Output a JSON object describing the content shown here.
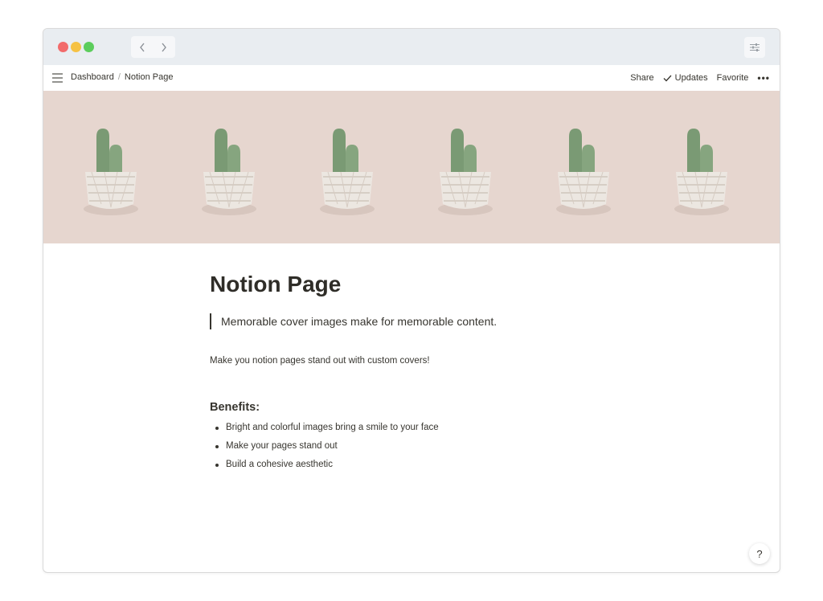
{
  "window": {
    "traffic_lights": [
      "close",
      "minimize",
      "zoom"
    ],
    "nav": {
      "back_icon": "chevron-left-icon",
      "forward_icon": "chevron-right-icon"
    },
    "settings_icon": "sliders-icon"
  },
  "topbar": {
    "breadcrumb": [
      "Dashboard",
      "Notion Page"
    ],
    "breadcrumb_separator": "/",
    "actions": {
      "share": "Share",
      "updates": "Updates",
      "favorite": "Favorite",
      "more": "•••"
    }
  },
  "cover": {
    "background": "#e6d6cf",
    "image": "repeating potted cactus pattern",
    "cactus_count": 6
  },
  "page": {
    "title": "Notion Page",
    "quote": "Memorable cover images make for memorable content.",
    "paragraph": "Make you notion pages stand out with custom covers!",
    "benefits_heading": "Benefits:",
    "benefits": [
      "Bright and colorful images bring a smile to your face",
      "Make your pages stand out",
      "Build a cohesive aesthetic"
    ]
  },
  "help_button": "?",
  "colors": {
    "text": "#37352f",
    "titlebar": "#e9edf1",
    "close": "#f26b6b",
    "minimize": "#f6c244",
    "zoom": "#5ccd5c"
  }
}
